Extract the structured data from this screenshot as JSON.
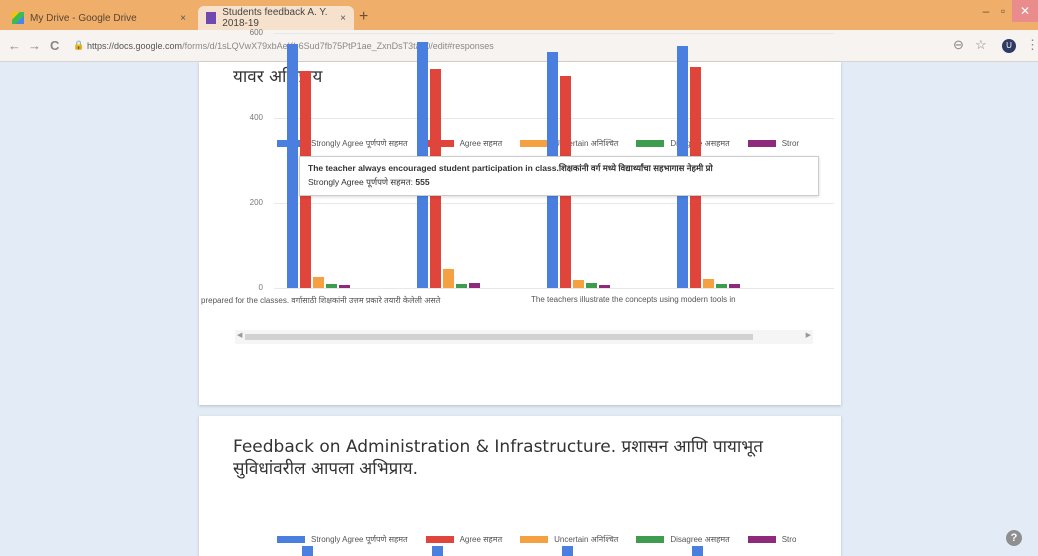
{
  "browser": {
    "tabs": [
      {
        "title": "My Drive - Google Drive",
        "close": "×"
      },
      {
        "title": "Students feedback A. Y. 2018-19",
        "close": "×"
      }
    ],
    "new_tab": "+",
    "window_controls": {
      "minimize": "–",
      "maximize": "▫",
      "close": "✕"
    },
    "nav": {
      "back": "←",
      "forward": "→",
      "reload": "C"
    },
    "url_host": "https://docs.google.com",
    "url_path": "/forms/d/1sLQVwX79xbAeKl-6Sud7fb75PtP1ae_ZxnDsT3tay0/edit#responses",
    "zoom_icon": "⊖",
    "star_icon": "☆",
    "avatar_letter": "U",
    "menu_icon": "⋮"
  },
  "section1": {
    "title": "यावर अभिप्राय",
    "tooltip": {
      "question": "The teacher always encouraged student participation in class.शिक्षकांनी वर्ग मध्ये विद्यार्थ्यांचा सहभागास नेहमी प्रो",
      "series_label": "Strongly Agree पूर्णपणे सहमत:",
      "value": "555"
    }
  },
  "section2": {
    "title_line1": "Feedback on Administration & Infrastructure. प्रशासन आणि पायाभूत",
    "title_line2": "सुविधांवरील आपला अभिप्राय."
  },
  "colors": {
    "strongly_agree": "#4a7fe0",
    "agree": "#e0453c",
    "uncertain": "#f5a041",
    "disagree": "#3d9c4d",
    "strongly_disagree": "#8e2a7b"
  },
  "chart_data": [
    {
      "type": "bar",
      "ylim": [
        0,
        600
      ],
      "yticks": [
        "600",
        "400",
        "200",
        "0"
      ],
      "legend": [
        {
          "name": "Strongly Agree पूर्णपणे सहमत",
          "color": "#4a7fe0"
        },
        {
          "name": "Agree सहमत",
          "color": "#e0453c"
        },
        {
          "name": "Uncertain अनिश्चित",
          "color": "#f5a041"
        },
        {
          "name": "Disagree असहमत",
          "color": "#3d9c4d"
        },
        {
          "name": "Stror",
          "color": "#8e2a7b"
        }
      ],
      "categories": [
        "prepared for the classes. वर्गासाठी शिक्षकांनी उत्तम प्रकारे तयारी केलेली असते",
        "",
        "The teachers illustrate the concepts using modern tools in",
        ""
      ],
      "series": [
        {
          "name": "Strongly Agree पूर्णपणे सहमत",
          "values": [
            575,
            580,
            555,
            570
          ]
        },
        {
          "name": "Agree सहमत",
          "values": [
            510,
            515,
            500,
            520
          ]
        },
        {
          "name": "Uncertain अनिश्चित",
          "values": [
            25,
            45,
            20,
            22
          ]
        },
        {
          "name": "Disagree असहमत",
          "values": [
            10,
            10,
            12,
            10
          ]
        },
        {
          "name": "Stror",
          "values": [
            8,
            12,
            6,
            10
          ]
        }
      ]
    },
    {
      "type": "bar",
      "legend": [
        {
          "name": "Strongly Agree पूर्णपणे सहमत",
          "color": "#4a7fe0"
        },
        {
          "name": "Agree सहमत",
          "color": "#e0453c"
        },
        {
          "name": "Uncertain अनिश्चित",
          "color": "#f5a041"
        },
        {
          "name": "Disagree असहमत",
          "color": "#3d9c4d"
        },
        {
          "name": "Stro",
          "color": "#8e2a7b"
        }
      ]
    }
  ],
  "help_icon": "?"
}
